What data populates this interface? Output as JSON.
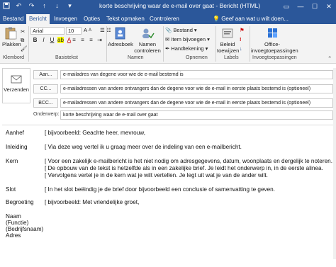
{
  "window": {
    "title": "korte beschrijving waar de e-mail over gaat  -  Bericht (HTML)",
    "qat": [
      "save-icon",
      "undo-icon",
      "redo-icon",
      "up-icon",
      "down-icon",
      "more-icon"
    ],
    "controls": [
      "ribbon-display-icon",
      "minimize-icon",
      "maximize-icon",
      "close-icon"
    ]
  },
  "tabs": [
    {
      "label": "Bestand",
      "active": false
    },
    {
      "label": "Bericht",
      "active": true
    },
    {
      "label": "Invoegen",
      "active": false
    },
    {
      "label": "Opties",
      "active": false
    },
    {
      "label": "Tekst opmaken",
      "active": false
    },
    {
      "label": "Controleren",
      "active": false
    }
  ],
  "tellme": "Geef aan wat u wilt doen...",
  "ribbon": {
    "clipboard": {
      "paste": "Plakken",
      "group": "Klembord"
    },
    "text": {
      "font": "Arial",
      "size": "10",
      "group": "Basistekst"
    },
    "names": {
      "addressbook": "Adresboek",
      "check": "Namen controleren",
      "group": "Namen"
    },
    "include": {
      "attach": "Bestand",
      "item": "Item bijvoegen",
      "signature": "Handtekening",
      "group": "Opnemen"
    },
    "tags": {
      "followup": "Beleid toewijzen",
      "group": "Labels"
    },
    "addins": {
      "office": "Office-invoegtoepassingen",
      "group": "Invoegtoepassingen"
    }
  },
  "header": {
    "send": "Verzenden",
    "to_btn": "Aan...",
    "to_value": "e-mailadres van degene voor wie de e-mail bestemd is",
    "cc_btn": "CC...",
    "cc_value": "e-mailadressen van andere ontvangers dan de degene voor wie de e-mail in eerste plaats bestemd is (optioneel)",
    "bcc_btn": "BCC...",
    "bcc_value": "e-mailadressen van andere ontvangers dan de degene voor wie de e-mail in eerste plaats bestemd is (optioneel)",
    "subject_label": "Onderwerp:",
    "subject_value": "korte beschrijving waar de e-mail over gaat"
  },
  "body": {
    "aanhef_label": "Aanhef",
    "aanhef_text": "[ bijvoorbeeld: Geachte heer, mevrouw,",
    "inleiding_label": "Inleiding",
    "inleiding_text": "[ Via deze weg vertel ik u graag meer over de indeling van een e-mailbericht.",
    "kern_label": "Kern",
    "kern_line1": "[ Voor een zakelijk e-mailbericht is het niet nodig om adresgegevens, datum, woonplaats en dergelijk te noteren.",
    "kern_line2": "[ De opbouw van de tekst is hetzelfde als in een zakelijke brief. Je leidt het onderwerp in, in de eerste alinea.",
    "kern_line3": "[  Vervolgens vertel je in de kern wat je wilt vertellen. Je legt uit wat je van de ander wilt.",
    "slot_label": "Slot",
    "slot_text": "[ In het slot beëindig je de brief door bijvoorbeeld een conclusie of samenvatting te geven.",
    "begroeting_label": "Begroeting",
    "begroeting_text": "[ bijvoorbeeld: Met vriendelijke groet,",
    "sig1": "Naam",
    "sig2": "(Functie)",
    "sig3": "(Bedrijfsnaam)",
    "sig4": "Adres"
  }
}
